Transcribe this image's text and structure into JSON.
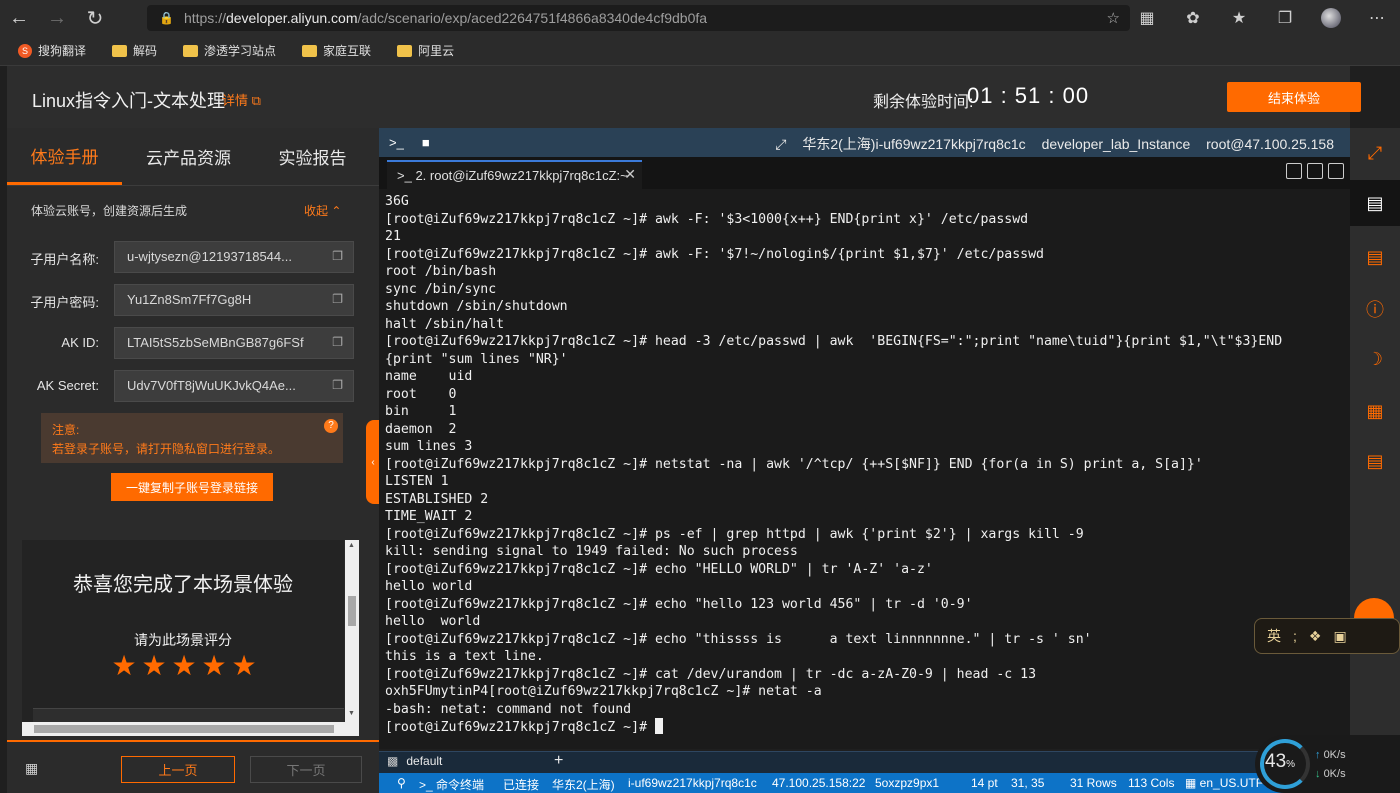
{
  "browser": {
    "url_prefix": "https://",
    "url_host": "developer.aliyun.com",
    "url_path": "/adc/scenario/exp/aced2264751f4866a8340de4cf9db0fa",
    "bookmarks": [
      "搜狗翻译",
      "解码",
      "渗透学习站点",
      "家庭互联",
      "阿里云"
    ]
  },
  "header": {
    "title": "Linux指令入门-文本处理",
    "detail_link": "详情",
    "timer_label": "剩余体验时间:",
    "timer_value": "01 : 51 : 00",
    "end_button": "结束体验"
  },
  "left": {
    "tabs": [
      "体验手册",
      "云产品资源",
      "实验报告"
    ],
    "account_head": "体验云账号，创建资源后生成",
    "collapse": "收起",
    "fields": [
      {
        "label": "子用户名称:",
        "value": "u-wjtysezn@12193718544..."
      },
      {
        "label": "子用户密码:",
        "value": "Yu1Zn8Sm7Ff7Gg8H"
      },
      {
        "label": "AK ID:",
        "value": "LTAI5tS5zbSeMBnGB87g6FSf"
      },
      {
        "label": "AK Secret:",
        "value": "Udv7V0fT8jWuUKJvkQ4Ae..."
      }
    ],
    "notice_title": "注意:",
    "notice_text": "若登录子账号，请打开隐私窗口进行登录。",
    "copy_link_button": "一键复制子账号登录链接",
    "congrats_title": "恭喜您完成了本场景体验",
    "rate_label": "请为此场景评分",
    "stars": 5,
    "prev_button": "上一页",
    "next_button": "下一页"
  },
  "terminal": {
    "top_region": "华东2(上海)i-uf69wz217kkpj7rq8c1c",
    "top_name": "developer_lab_Instance",
    "top_host": "root@47.100.25.158",
    "tab_title": "2. root@iZuf69wz217kkpj7rq8c1cZ:~",
    "lines": [
      "36G",
      "[root@iZuf69wz217kkpj7rq8c1cZ ~]# awk -F: '$3<1000{x++} END{print x}' /etc/passwd",
      "21",
      "[root@iZuf69wz217kkpj7rq8c1cZ ~]# awk -F: '$7!~/nologin$/{print $1,$7}' /etc/passwd",
      "root /bin/bash",
      "sync /bin/sync",
      "shutdown /sbin/shutdown",
      "halt /sbin/halt",
      "[root@iZuf69wz217kkpj7rq8c1cZ ~]# head -3 /etc/passwd | awk  'BEGIN{FS=\":\";print \"name\\tuid\"}{print $1,\"\\t\"$3}END",
      "{print \"sum lines \"NR}'",
      "name    uid",
      "root    0",
      "bin     1",
      "daemon  2",
      "sum lines 3",
      "[root@iZuf69wz217kkpj7rq8c1cZ ~]# netstat -na | awk '/^tcp/ {++S[$NF]} END {for(a in S) print a, S[a]}'",
      "LISTEN 1",
      "ESTABLISHED 2",
      "TIME_WAIT 2",
      "[root@iZuf69wz217kkpj7rq8c1cZ ~]# ps -ef | grep httpd | awk {'print $2'} | xargs kill -9",
      "kill: sending signal to 1949 failed: No such process",
      "[root@iZuf69wz217kkpj7rq8c1cZ ~]# echo \"HELLO WORLD\" | tr 'A-Z' 'a-z'",
      "hello world",
      "[root@iZuf69wz217kkpj7rq8c1cZ ~]# echo \"hello 123 world 456\" | tr -d '0-9'",
      "hello  world",
      "[root@iZuf69wz217kkpj7rq8c1cZ ~]# echo \"thissss is      a text linnnnnnne.\" | tr -s ' sn'",
      "this is a text line.",
      "[root@iZuf69wz217kkpj7rq8c1cZ ~]# cat /dev/urandom | tr -dc a-zA-Z0-9 | head -c 13",
      "oxh5FUmytinP4[root@iZuf69wz217kkpj7rq8c1cZ ~]# netat -a",
      "-bash: netat: command not found"
    ],
    "prompt": "[root@iZuf69wz217kkpj7rq8c1cZ ~]# ",
    "bottom_tab": "default",
    "status": {
      "term": "命令终端",
      "state": "已连接",
      "region": "华东2(上海)",
      "instance": "i-uf69wz217kkpj7rq8c1c",
      "addr": "47.100.25.158:22",
      "user": "5oxzpz9px1",
      "font": "14 pt",
      "pos": "31, 35",
      "rows": "31 Rows",
      "cols": "113 Cols",
      "locale": "en_US.UTF-8"
    }
  },
  "ime": {
    "lang": "英",
    "punct": ";"
  },
  "net": {
    "percent": "43",
    "pct_sign": "%",
    "up": "0K/s",
    "down": "0K/s"
  }
}
